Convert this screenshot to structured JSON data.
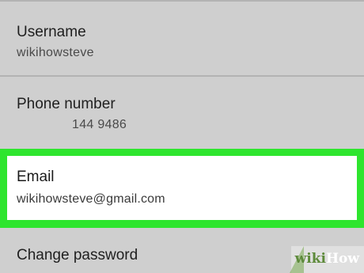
{
  "rows": {
    "username": {
      "label": "Username",
      "value": "wikihowsteve"
    },
    "phone": {
      "label": "Phone number",
      "value": "144 9486"
    },
    "email": {
      "label": "Email",
      "value": "wikihowsteve@gmail.com"
    },
    "change_password": {
      "label": "Change password"
    }
  },
  "highlight_color": "#2ee52e",
  "watermark": {
    "wiki": "wiki",
    "how": "How"
  }
}
